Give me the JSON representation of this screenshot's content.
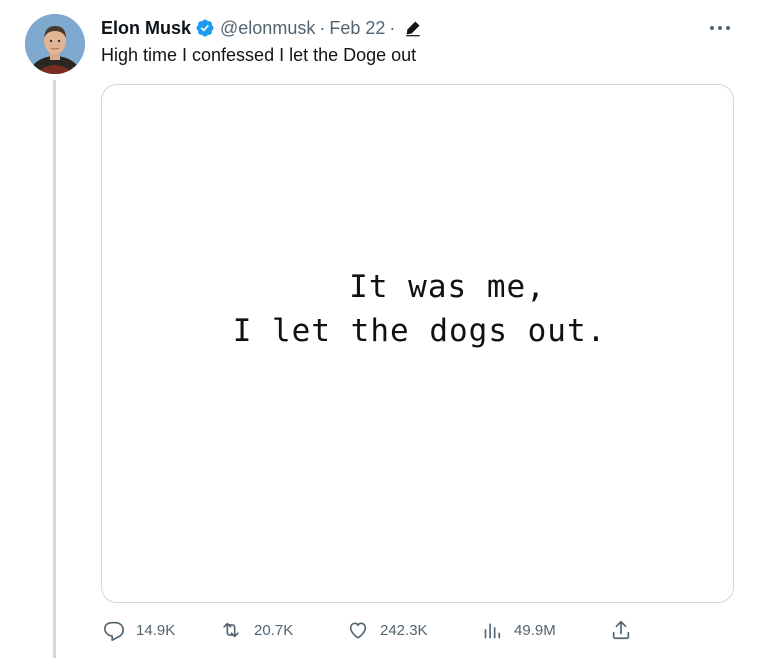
{
  "tweet": {
    "author_name": "Elon Musk",
    "handle": "@elonmusk",
    "separator": "·",
    "date": "Feb 22",
    "text": "High time I confessed I let the Doge out",
    "media_text_line1": "It was me,",
    "media_text_line2": "I let the dogs out.",
    "verified": true,
    "icons": {
      "verified": "verified-badge-icon",
      "edited": "edit-pencil-icon",
      "more": "more-dots-icon",
      "reply": "reply-icon",
      "repost": "repost-icon",
      "like": "heart-icon",
      "views": "views-chart-icon",
      "share": "share-icon"
    }
  },
  "actions": {
    "replies": "14.9K",
    "reposts": "20.7K",
    "likes": "242.3K",
    "views": "49.9M"
  },
  "colors": {
    "verified_blue": "#1d9bf0",
    "secondary_text": "#536471",
    "thread_line": "#cfd9de",
    "border": "#cfd9de"
  }
}
